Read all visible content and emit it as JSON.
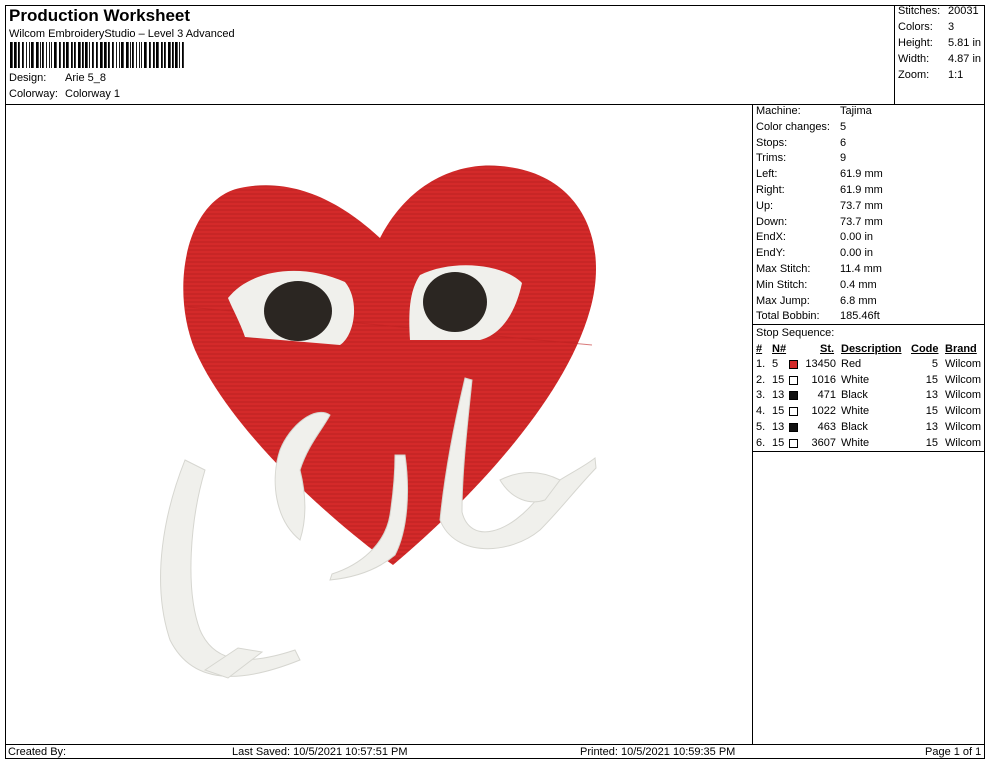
{
  "header": {
    "title": "Production Worksheet",
    "subtitle": "Wilcom EmbroideryStudio – Level 3 Advanced",
    "design_label": "Design:",
    "design_value": "Arie 5_8",
    "colorway_label": "Colorway:",
    "colorway_value": "Colorway 1"
  },
  "stats": {
    "stitches_label": "Stitches:",
    "stitches_value": "20031",
    "colors_label": "Colors:",
    "colors_value": "3",
    "height_label": "Height:",
    "height_value": "5.81 in",
    "width_label": "Width:",
    "width_value": "4.87 in",
    "zoom_label": "Zoom:",
    "zoom_value": "1:1"
  },
  "params": [
    {
      "k": "Machine:",
      "v": "Tajima"
    },
    {
      "k": "Color changes:",
      "v": "5"
    },
    {
      "k": "Stops:",
      "v": "6"
    },
    {
      "k": "Trims:",
      "v": "9"
    },
    {
      "k": "Left:",
      "v": "61.9 mm"
    },
    {
      "k": "Right:",
      "v": "61.9 mm"
    },
    {
      "k": "Up:",
      "v": "73.7 mm"
    },
    {
      "k": "Down:",
      "v": "73.7 mm"
    },
    {
      "k": "EndX:",
      "v": "0.00 in"
    },
    {
      "k": "EndY:",
      "v": "0.00 in"
    },
    {
      "k": "Max Stitch:",
      "v": "11.4 mm"
    },
    {
      "k": "Min Stitch:",
      "v": "0.4 mm"
    },
    {
      "k": "Max Jump:",
      "v": "6.8 mm"
    },
    {
      "k": "Total Bobbin:",
      "v": "185.46ft"
    }
  ],
  "stop_sequence": {
    "title": "Stop Sequence:",
    "headers": {
      "num": "#",
      "n": "N#",
      "st": "St.",
      "desc": "Description",
      "code": "Code",
      "brand": "Brand"
    },
    "rows": [
      {
        "num": "1.",
        "n": "5",
        "color": "#d42a2a",
        "st": "13450",
        "desc": "Red",
        "code": "5",
        "brand": "Wilcom"
      },
      {
        "num": "2.",
        "n": "15",
        "color": "#ffffff",
        "st": "1016",
        "desc": "White",
        "code": "15",
        "brand": "Wilcom"
      },
      {
        "num": "3.",
        "n": "13",
        "color": "#111111",
        "st": "471",
        "desc": "Black",
        "code": "13",
        "brand": "Wilcom"
      },
      {
        "num": "4.",
        "n": "15",
        "color": "#ffffff",
        "st": "1022",
        "desc": "White",
        "code": "15",
        "brand": "Wilcom"
      },
      {
        "num": "5.",
        "n": "13",
        "color": "#111111",
        "st": "463",
        "desc": "Black",
        "code": "13",
        "brand": "Wilcom"
      },
      {
        "num": "6.",
        "n": "15",
        "color": "#ffffff",
        "st": "3607",
        "desc": "White",
        "code": "15",
        "brand": "Wilcom"
      }
    ]
  },
  "footer": {
    "created_by": "Created By:",
    "last_saved": "Last Saved: 10/5/2021 10:57:51 PM",
    "printed": "Printed: 10/5/2021 10:59:35 PM",
    "page": "Page 1 of 1"
  },
  "colors": {
    "heart_red": "#d42a2a",
    "thread_white": "#f0f0ec",
    "eye_black": "#2b2622"
  }
}
